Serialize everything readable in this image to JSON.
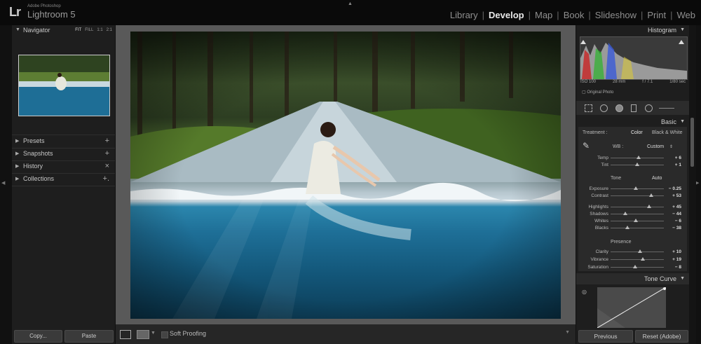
{
  "app": {
    "logo": "Lr",
    "vendor": "Adobe Photoshop",
    "name": "Lightroom 5"
  },
  "modules": [
    {
      "label": "Library",
      "active": false
    },
    {
      "label": "Develop",
      "active": true
    },
    {
      "label": "Map",
      "active": false
    },
    {
      "label": "Book",
      "active": false
    },
    {
      "label": "Slideshow",
      "active": false
    },
    {
      "label": "Print",
      "active": false
    },
    {
      "label": "Web",
      "active": false
    }
  ],
  "left": {
    "navigator": {
      "title": "Navigator",
      "zoom_options": [
        "FIT",
        "FILL",
        "1:1",
        "2:1"
      ],
      "active_zoom": "FIT"
    },
    "panels": [
      {
        "label": "Presets",
        "action": "+"
      },
      {
        "label": "Snapshots",
        "action": "+"
      },
      {
        "label": "History",
        "action": "×"
      },
      {
        "label": "Collections",
        "action": "+."
      }
    ],
    "copy_label": "Copy...",
    "paste_label": "Paste"
  },
  "toolbar": {
    "soft_proofing_label": "Soft Proofing",
    "soft_proofing_checked": false
  },
  "right": {
    "histogram": {
      "title": "Histogram",
      "iso": "ISO 100",
      "focal": "28 mm",
      "aperture": "f / 7.1",
      "shutter": "1/80 sec",
      "original_photo_label": "Original Photo"
    },
    "basic": {
      "title": "Basic",
      "treatment_label": "Treatment :",
      "treatment_color": "Color",
      "treatment_bw": "Black & White",
      "wb_label": "WB :",
      "wb_value": "Custom",
      "wb_sliders": [
        {
          "label": "Temp",
          "value": "+ 6",
          "pos": 0.52
        },
        {
          "label": "Tint",
          "value": "+ 1",
          "pos": 0.5
        }
      ],
      "tone_label": "Tone",
      "auto_label": "Auto",
      "tone_sliders": [
        {
          "label": "Exposure",
          "value": "− 0.25",
          "pos": 0.48
        },
        {
          "label": "Contrast",
          "value": "+ 53",
          "pos": 0.76
        }
      ],
      "tone_sliders_2": [
        {
          "label": "Highlights",
          "value": "+ 45",
          "pos": 0.72
        },
        {
          "label": "Shadows",
          "value": "− 44",
          "pos": 0.28
        },
        {
          "label": "Whites",
          "value": "− 6",
          "pos": 0.47
        },
        {
          "label": "Blacks",
          "value": "− 38",
          "pos": 0.31
        }
      ],
      "presence_label": "Presence",
      "presence_sliders": [
        {
          "label": "Clarity",
          "value": "+ 10",
          "pos": 0.55
        },
        {
          "label": "Vibrance",
          "value": "+ 19",
          "pos": 0.6
        },
        {
          "label": "Saturation",
          "value": "− 8",
          "pos": 0.46
        }
      ]
    },
    "tone_curve": {
      "title": "Tone Curve"
    },
    "previous_label": "Previous",
    "reset_label": "Reset (Adobe)"
  },
  "colors": {
    "accent": "#e8e8e8",
    "panel_bg": "#1e1e1e",
    "center_bg": "#595959"
  }
}
